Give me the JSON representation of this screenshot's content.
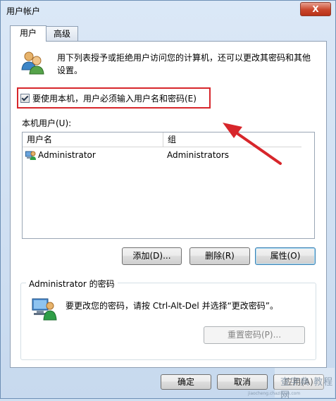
{
  "window": {
    "title": "用户帐户",
    "close_glyph": "X"
  },
  "tabs": [
    {
      "label": "用户"
    },
    {
      "label": "高级"
    }
  ],
  "intro": {
    "text": "用下列表授予或拒绝用户访问您的计算机，还可以更改其密码和其他设置。"
  },
  "require_login": {
    "label": "要使用本机，用户必须输入用户名和密码(E)",
    "checked": true
  },
  "users_list": {
    "label": "本机用户(U):",
    "columns": [
      "用户名",
      "组"
    ],
    "rows": [
      {
        "name": "Administrator",
        "group": "Administrators"
      }
    ]
  },
  "buttons": {
    "add": "添加(D)...",
    "delete": "删除(R)",
    "properties": "属性(O)"
  },
  "password_group": {
    "title": "Administrator 的密码",
    "text": "要更改您的密码，请按 Ctrl-Alt-Del 并选择“更改密码”。",
    "reset_button": "重置密码(P)..."
  },
  "footer": {
    "ok": "确定",
    "cancel": "取消",
    "apply": "应用(A)"
  },
  "watermark": {
    "sign": "查字典",
    "site": "教程网",
    "url": "jiaocheng.chazidian.com"
  },
  "colors": {
    "highlight": "#d7262b",
    "arrow": "#d7262b",
    "accent": "#3c7fb1"
  },
  "icons": {
    "users": "users-icon",
    "admin": "user-icon",
    "computer": "computer-user-icon",
    "close": "close-icon",
    "checkbox": "checkmark-icon"
  }
}
